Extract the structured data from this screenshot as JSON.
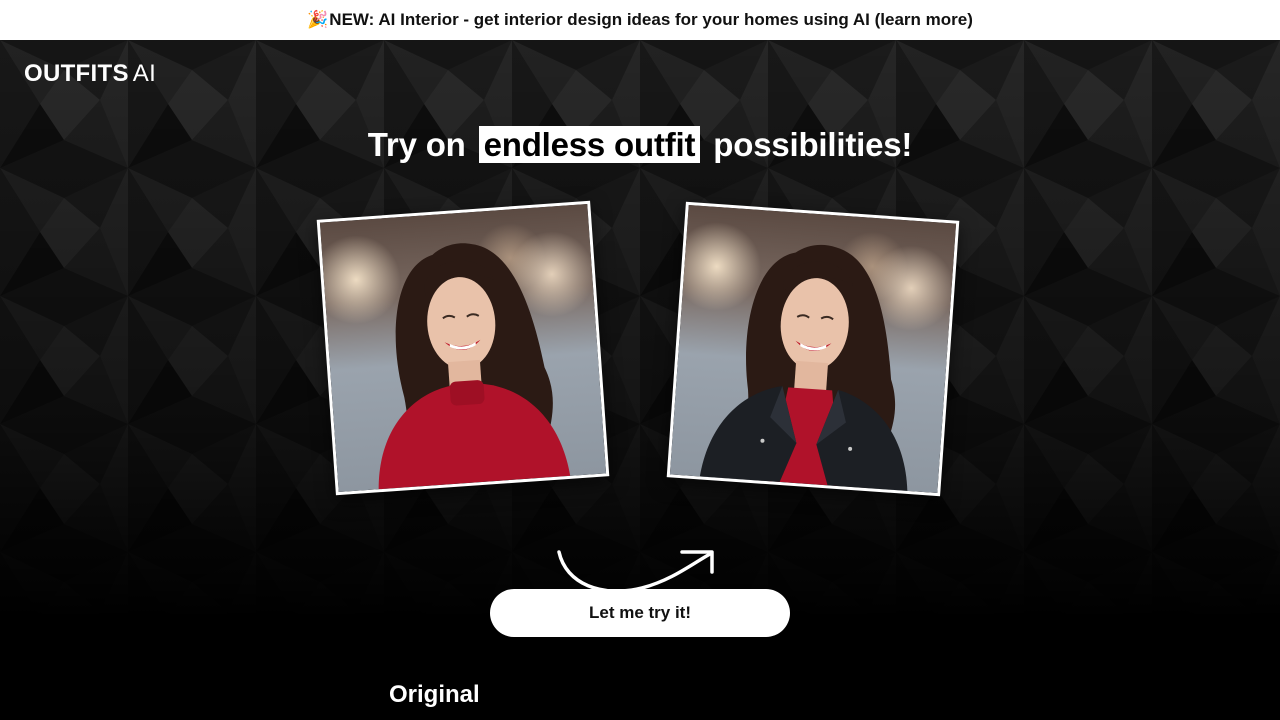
{
  "announcement": {
    "emoji": "🎉",
    "text": "NEW: AI Interior - get interior design ideas for your homes using AI (learn more)"
  },
  "brand": {
    "strong": "OUTFITS",
    "light": "AI"
  },
  "hero": {
    "headline_before": "Try on",
    "headline_highlight": "endless outfit",
    "headline_after": "possibilities!",
    "cta_label": "Let me try it!"
  },
  "section": {
    "title": "Original"
  },
  "colors": {
    "background": "#000000",
    "accent": "#ffffff",
    "sweater": "#b0122a",
    "jacket": "#1c1f24"
  },
  "images": {
    "original": "woman-red-sweater-photo",
    "result": "woman-leather-jacket-photo"
  }
}
